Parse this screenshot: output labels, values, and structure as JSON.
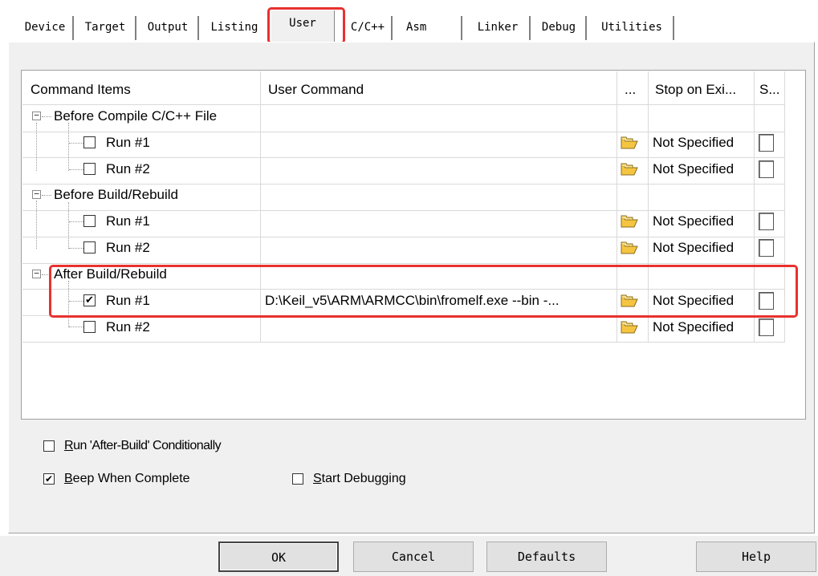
{
  "tabs": [
    {
      "label": "Device"
    },
    {
      "label": "Target"
    },
    {
      "label": "Output"
    },
    {
      "label": "Listing"
    },
    {
      "label": "User"
    },
    {
      "label": "C/C++"
    },
    {
      "label": "Asm"
    },
    {
      "label": "Linker"
    },
    {
      "label": "Debug"
    },
    {
      "label": "Utilities"
    }
  ],
  "active_tab": "User",
  "table": {
    "columns": [
      "Command Items",
      "User Command",
      "...",
      "Stop on Exi...",
      "S..."
    ],
    "groups": [
      {
        "label": "Before Compile C/C++ File",
        "expander": "−",
        "rows": [
          {
            "label": "Run #1",
            "checked": "",
            "command": "",
            "stop": "Not Specified"
          },
          {
            "label": "Run #2",
            "checked": "",
            "command": "",
            "stop": "Not Specified"
          }
        ]
      },
      {
        "label": "Before Build/Rebuild",
        "expander": "−",
        "rows": [
          {
            "label": "Run #1",
            "checked": "",
            "command": "",
            "stop": "Not Specified"
          },
          {
            "label": "Run #2",
            "checked": "",
            "command": "",
            "stop": "Not Specified"
          }
        ]
      },
      {
        "label": "After Build/Rebuild",
        "expander": "−",
        "rows": [
          {
            "label": "Run #1",
            "checked": "✔",
            "command": "D:\\Keil_v5\\ARM\\ARMCC\\bin\\fromelf.exe --bin -...",
            "stop": "Not Specified"
          },
          {
            "label": "Run #2",
            "checked": "",
            "command": "",
            "stop": "Not Specified"
          }
        ]
      }
    ]
  },
  "options": {
    "run_after_build": {
      "label_pre": "",
      "mnemonic": "R",
      "label_post": "un 'After-Build' Conditionally",
      "checked": ""
    },
    "beep": {
      "mnemonic": "B",
      "label_post": "eep When Complete",
      "checked": "✔"
    },
    "start_debugging": {
      "mnemonic": "S",
      "label_post": "tart Debugging",
      "checked": ""
    }
  },
  "buttons": {
    "ok": "OK",
    "cancel": "Cancel",
    "defaults": "Defaults",
    "help": "Help"
  },
  "colors": {
    "highlight": "#e8312f",
    "dialog_bg": "#f0f0f0",
    "folder": "#f5c542"
  }
}
